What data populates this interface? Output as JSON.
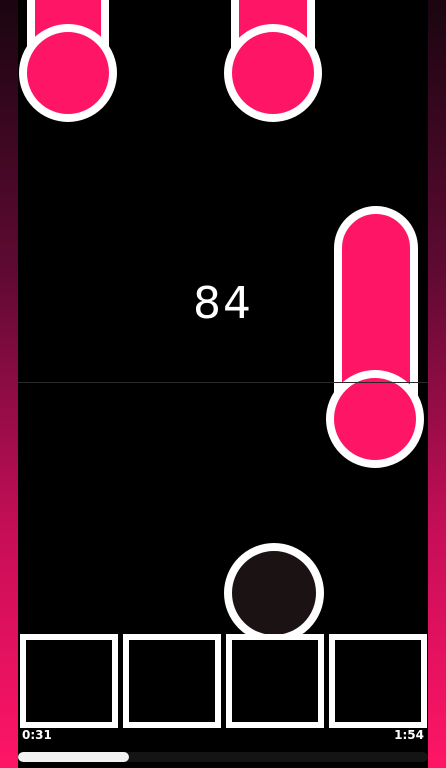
{
  "game": {
    "score": "84"
  },
  "player": {
    "time_elapsed": "0:31",
    "time_total": "1:54",
    "progress": 0.27
  },
  "colors": {
    "tile": "#ff1566",
    "outline": "#ffffff",
    "background": "#000000",
    "ball": "#1a1213"
  }
}
